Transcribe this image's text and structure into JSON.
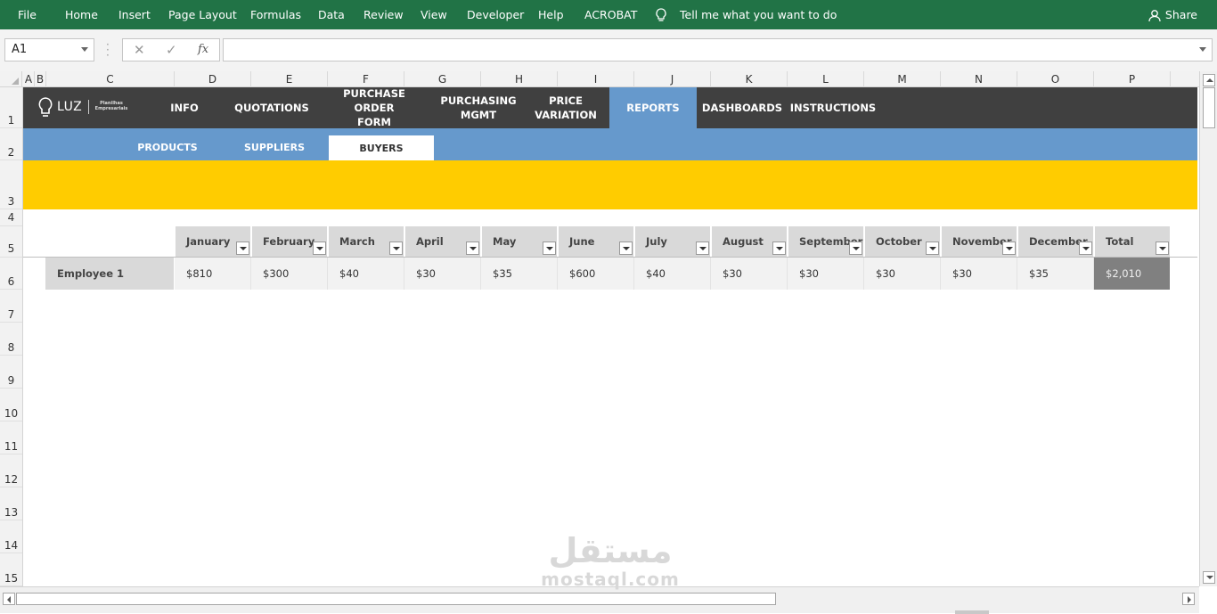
{
  "ribbon": {
    "tabs": [
      "File",
      "Home",
      "Insert",
      "Page Layout",
      "Formulas",
      "Data",
      "Review",
      "View",
      "Developer",
      "Help",
      "ACROBAT"
    ],
    "tell_me": "Tell me what you want to do",
    "share": "Share"
  },
  "formula_bar": {
    "name_box": "A1",
    "fx": "fx",
    "formula": ""
  },
  "columns": [
    "A",
    "B",
    "C",
    "D",
    "E",
    "F",
    "G",
    "H",
    "I",
    "J",
    "K",
    "L",
    "M",
    "N",
    "O",
    "P"
  ],
  "rows": [
    "1",
    "2",
    "3",
    "4",
    "5",
    "6",
    "7",
    "8",
    "9",
    "10",
    "11",
    "12",
    "13",
    "14",
    "15"
  ],
  "logo": {
    "brand": "LUZ",
    "subtitle": "Planilhas Empresariais"
  },
  "nav": {
    "items": [
      "INFO",
      "QUOTATIONS",
      "PURCHASE ORDER\nFORM",
      "PURCHASING\nMGMT",
      "PRICE\nVARIATION",
      "REPORTS",
      "DASHBOARDS",
      "INSTRUCTIONS"
    ],
    "active": "REPORTS"
  },
  "subnav": {
    "items": [
      "PRODUCTS",
      "SUPPLIERS",
      "BUYERS"
    ],
    "active": "BUYERS"
  },
  "table": {
    "headers": [
      "January",
      "February",
      "March",
      "April",
      "May",
      "June",
      "July",
      "August",
      "September",
      "October",
      "November",
      "December",
      "Total"
    ],
    "row_label": "Employee 1",
    "values": [
      "$810",
      "$300",
      "$40",
      "$30",
      "$35",
      "$600",
      "$40",
      "$30",
      "$30",
      "$30",
      "$30",
      "$35",
      "$2,010"
    ]
  },
  "watermark": {
    "arabic": "مستقل",
    "latin": "mostaql.com"
  },
  "colors": {
    "ribbon": "#217346",
    "nav_bar": "#404040",
    "accent_blue": "#6699cc",
    "banner_yellow": "#ffcc00",
    "header_gray": "#d9d9d9",
    "total_gray": "#808080"
  }
}
